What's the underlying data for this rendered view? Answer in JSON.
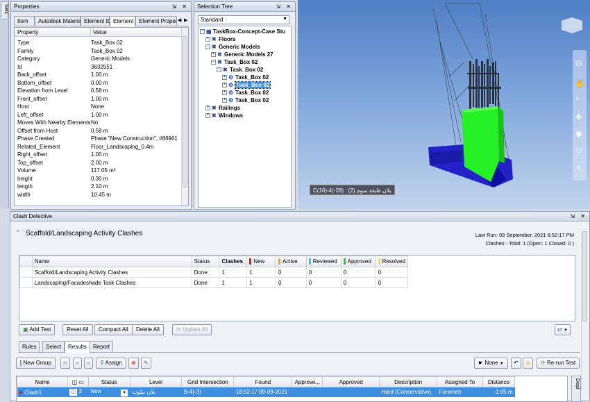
{
  "sidebar_tab": "Sets",
  "properties": {
    "title": "Properties",
    "tabs": [
      "Item",
      "Autodesk Material",
      "Element ID",
      "Element",
      "Element Propert"
    ],
    "header": {
      "property": "Property",
      "value": "Value"
    },
    "rows": [
      {
        "p": "Type",
        "v": "Task_Box 02"
      },
      {
        "p": "Family",
        "v": "Task_Box 02"
      },
      {
        "p": "Category",
        "v": "Generic Models"
      },
      {
        "p": "Id",
        "v": "3632551"
      },
      {
        "p": "Back_offset",
        "v": "1.00 m"
      },
      {
        "p": "Bottom_offset",
        "v": "0.00 m"
      },
      {
        "p": "Elevation from Level",
        "v": "0.58 m"
      },
      {
        "p": "Front_offset",
        "v": "1.00 m"
      },
      {
        "p": "Host",
        "v": "None"
      },
      {
        "p": "Left_offset",
        "v": "1.00 m"
      },
      {
        "p": "Moves With Nearby Elements",
        "v": "No"
      },
      {
        "p": "Offset from Host",
        "v": "0.58 m"
      },
      {
        "p": "Phase Created",
        "v": "Phase \"New Construction\", #86961"
      },
      {
        "p": "Related_Element",
        "v": "Floor_Landscaping_0.4m"
      },
      {
        "p": "Right_offset",
        "v": "1.00 m"
      },
      {
        "p": "Top_offset",
        "v": "2.00 m"
      },
      {
        "p": "Volume",
        "v": "117.05 m³"
      },
      {
        "p": "height",
        "v": "0.30 m"
      },
      {
        "p": "length",
        "v": "2.10 m"
      },
      {
        "p": "width",
        "v": "10.45 m"
      }
    ]
  },
  "selection_tree": {
    "title": "Selection Tree",
    "dropdown": "Standard",
    "items": [
      {
        "label": "TaskBox-Concept-Case Stu",
        "sel": false
      },
      {
        "label": "Floors",
        "sel": false
      },
      {
        "label": "Generic Models",
        "sel": false
      },
      {
        "label": "Generic Models 27",
        "sel": false
      },
      {
        "label": "Task_Box 02",
        "sel": false
      },
      {
        "label": "Task_Box 02",
        "sel": false
      },
      {
        "label": "Task_Box 02",
        "sel": false
      },
      {
        "label": "Task_Box 02",
        "sel": true
      },
      {
        "label": "Task_Box 02",
        "sel": false
      },
      {
        "label": "Task_Box 02",
        "sel": false
      },
      {
        "label": "Railings",
        "sel": false
      },
      {
        "label": "Windows",
        "sel": false
      }
    ]
  },
  "viewport": {
    "tooltip": "C(16)-4(-28) : بلان طبقة سوم (2)"
  },
  "clash": {
    "title": "Clash Detective",
    "test_name": "Scaffold/Landscaping Activity Clashes",
    "last_run": "Last Run:  09 September, 2021 6:52:17 PM",
    "clashes_summary": "Clashes - Total:  1  (Open:  1  Closed:  0 )",
    "columns": {
      "name": "Name",
      "status": "Status",
      "clashes": "Clashes",
      "new": "New",
      "active": "Active",
      "reviewed": "Reviewed",
      "approved": "Approved",
      "resolved": "Resolved"
    },
    "colors": {
      "new": "#e02020",
      "active": "#f0a030",
      "reviewed": "#40c8e8",
      "approved": "#30c030",
      "resolved": "#f0e040"
    },
    "tests": [
      {
        "name": "Scaffold/Landscaping Activity Clashes",
        "status": "Done",
        "clashes": "1",
        "new": "1",
        "active": "0",
        "reviewed": "0",
        "approved": "0",
        "resolved": "0"
      },
      {
        "name": "Landscaping/Facadeshade Task Clashes",
        "status": "Done",
        "clashes": "1",
        "new": "1",
        "active": "0",
        "reviewed": "0",
        "approved": "0",
        "resolved": "0"
      }
    ],
    "buttons": {
      "add_test": "Add Test",
      "reset_all": "Reset All",
      "compact_all": "Compact All",
      "delete_all": "Delete All",
      "update_all": "Update All"
    },
    "tabs": [
      "Rules",
      "Select",
      "Results",
      "Report"
    ],
    "results_toolbar": {
      "new_group": "New Group",
      "assign": "Assign",
      "none": "None",
      "rerun": "Re-run Test"
    },
    "results_columns": [
      "Name",
      "Status",
      "Level",
      "Grid Intersection",
      "Found",
      "Approve...",
      "Approved",
      "Description",
      "Assigned To",
      "Distance"
    ],
    "result_row": {
      "name": "Clash1",
      "count": "3",
      "status": "New",
      "level": "بلان بیلوت",
      "grid": "B-4(-3)",
      "found": "18:52:17 09-09-2021",
      "approver": "",
      "approved": "",
      "description": "Hard (Conservative)",
      "assigned": "Foremen",
      "distance": "-1.95 m"
    },
    "right_tab": "Displ"
  }
}
